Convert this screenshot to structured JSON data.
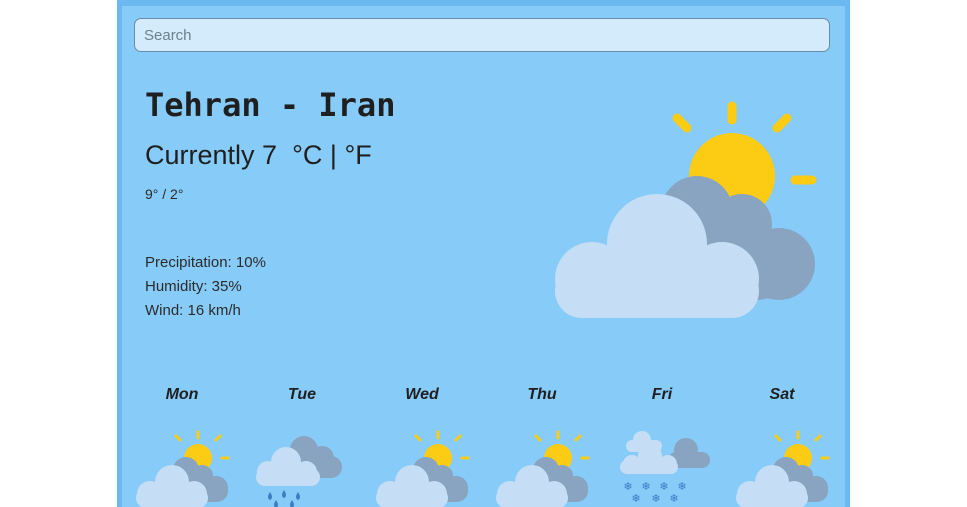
{
  "search": {
    "placeholder": "Search"
  },
  "location": {
    "title": "Tehran - Iran"
  },
  "current": {
    "label": "Currently",
    "temp": "7",
    "unit_c": "°C",
    "separator": "|",
    "unit_f": "°F",
    "hilo": "9° / 2°",
    "icon": "partly-cloudy-icon"
  },
  "details": {
    "precipitation": "Precipitation: 10%",
    "humidity": "Humidity: 35%",
    "wind": "Wind: 16 km/h"
  },
  "forecast": [
    {
      "day": "Mon",
      "icon": "partly-cloudy-icon"
    },
    {
      "day": "Tue",
      "icon": "rain-icon"
    },
    {
      "day": "Wed",
      "icon": "partly-cloudy-icon"
    },
    {
      "day": "Thu",
      "icon": "partly-cloudy-icon"
    },
    {
      "day": "Fri",
      "icon": "snow-icon"
    },
    {
      "day": "Sat",
      "icon": "partly-cloudy-icon"
    }
  ],
  "colors": {
    "background": "#87cbf8",
    "sun": "#fccc14",
    "cloud_light": "#c5def5",
    "cloud_dark": "#88a4c0",
    "rain": "#3b7ec4"
  }
}
